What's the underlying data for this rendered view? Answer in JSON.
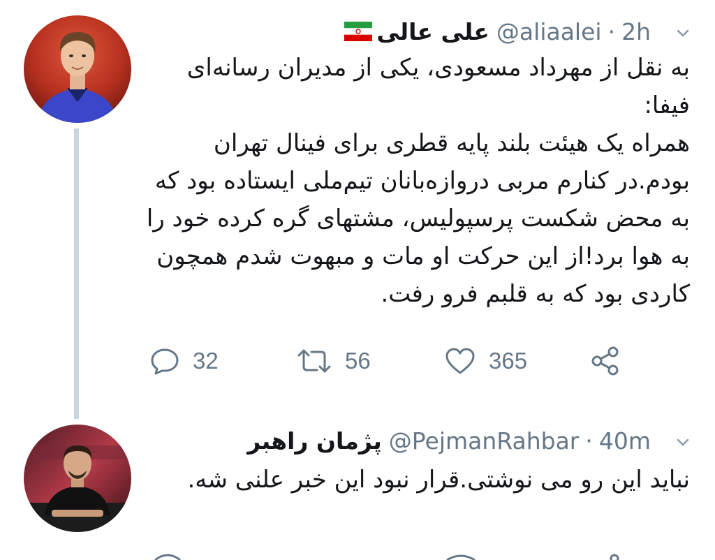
{
  "tweets": [
    {
      "name": "علی عالی",
      "handle": "@aliaalei",
      "separator": "·",
      "time": "2h",
      "has_flag": true,
      "body": [
        "به نقل از مهرداد مسعودی، یکی از مدیران رسانه‌ای فیفا:",
        "همراه یک هیئت بلند پایه قطری برای فینال تهران بودم.در کنارم مربی دروازه‌بانان تیم‌ملی ایستاده بود که به محض شکست پرسپولیس، مشتهای گره کرده خود را به هوا برد!از این حرکت او مات و مبهوت شدم همچون کاردی بود که به قلبم فرو رفت."
      ],
      "actions": {
        "reply_count": "32",
        "retweet_count": "56",
        "like_count": "365"
      }
    },
    {
      "name": "پژمان راهبر",
      "handle": "@PejmanRahbar",
      "separator": "·",
      "time": "40m",
      "body": [
        "نباید این رو می نوشتی.قرار نبود این خبر علنی شه."
      ]
    }
  ],
  "colors": {
    "text": "#14171a",
    "muted": "#657786",
    "thread_line": "#c9d6df",
    "flag_green": "#239f40",
    "flag_red": "#da0000"
  },
  "icons": [
    "reply-icon",
    "retweet-icon",
    "like-icon",
    "share-icon",
    "chevron-down-icon"
  ]
}
